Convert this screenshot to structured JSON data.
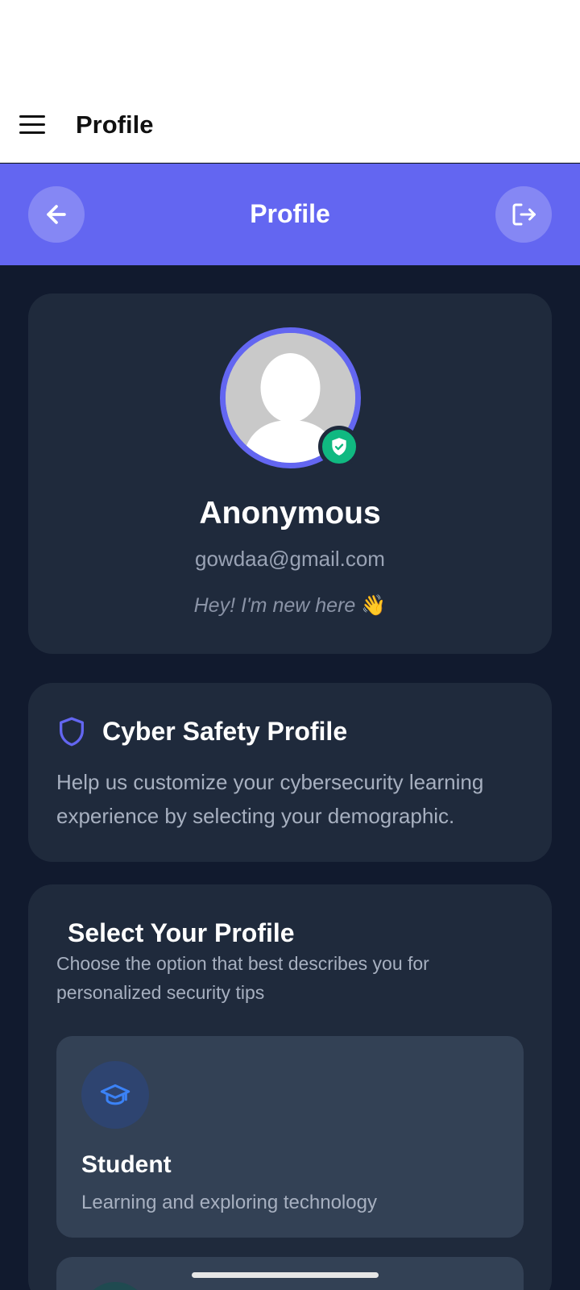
{
  "app_bar": {
    "title": "Profile"
  },
  "header": {
    "title": "Profile",
    "back_icon": "arrow-left-icon",
    "logout_icon": "logout-icon"
  },
  "profile": {
    "name": "Anonymous",
    "email": "gowdaa@gmail.com",
    "bio": "Hey! I'm new here",
    "bio_emoji": "👋",
    "verified_icon": "shield-check-icon"
  },
  "safety": {
    "title": "Cyber Safety Profile",
    "description": "Help us customize your cybersecurity learning experience by selecting your demographic.",
    "icon": "shield-icon"
  },
  "select": {
    "title": "Select Your Profile",
    "description": "Choose the option that best describes you for personalized security tips",
    "options": [
      {
        "title": "Student",
        "description": "Learning and exploring technology",
        "icon": "graduation-cap-icon"
      }
    ]
  },
  "colors": {
    "accent": "#6366f1",
    "background": "#111a2e",
    "card": "#1f2a3c",
    "verified": "#10b981"
  }
}
